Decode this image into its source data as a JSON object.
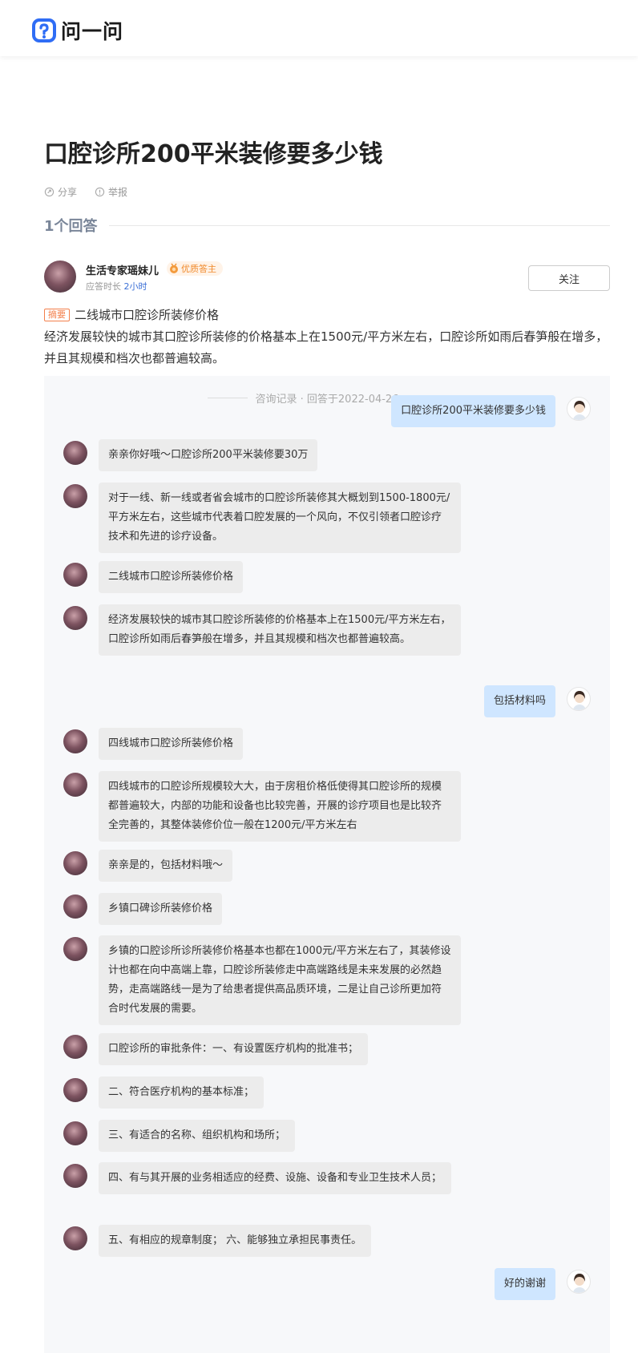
{
  "header": {
    "logo_text": "问一问"
  },
  "question": {
    "title": "口腔诊所200平米装修要多少钱",
    "share_label": "分享",
    "report_label": "举报"
  },
  "answers": {
    "count_label": "1个回答"
  },
  "author": {
    "name": "生活专家瑶妹儿",
    "badge": "优质答主",
    "meta_prefix": "应答时长",
    "meta_value": "2小时",
    "follow_label": "关注"
  },
  "summary": {
    "tag": "摘要",
    "heading": "二线城市口腔诊所装修价格",
    "body": "经济发展较快的城市其口腔诊所装修的价格基本上在1500元/平方米左右，口腔诊所如雨后春笋般在增多，并且其规模和档次也都普遍较高。"
  },
  "record": {
    "header": "咨询记录 · 回答于2022-04-26",
    "messages": [
      {
        "side": "user",
        "text": "口腔诊所200平米装修要多少钱"
      },
      {
        "side": "expert",
        "text": "亲亲你好哦～口腔诊所200平米装修要30万"
      },
      {
        "side": "expert",
        "text": "对于一线、新一线或者省会城市的口腔诊所装修其大概划到1500-1800元/平方米左右，这些城市代表着口腔发展的一个风向，不仅引领者口腔诊疗技术和先进的诊疗设备。"
      },
      {
        "side": "expert",
        "text": "二线城市口腔诊所装修价格"
      },
      {
        "side": "expert",
        "text": "经济发展较快的城市其口腔诊所装修的价格基本上在1500元/平方米左右，口腔诊所如雨后春笋般在增多，并且其规模和档次也都普遍较高。"
      },
      {
        "side": "user",
        "text": "包括材料吗"
      },
      {
        "side": "expert",
        "text": "四线城市口腔诊所装修价格"
      },
      {
        "side": "expert",
        "text": "四线城市的口腔诊所规模较大大，由于房租价格低使得其口腔诊所的规模都普遍较大，内部的功能和设备也比较完善，开展的诊疗项目也是比较齐全完善的，其整体装修价位一般在1200元/平方米左右"
      },
      {
        "side": "expert",
        "text": "亲亲是的，包括材料哦～"
      },
      {
        "side": "expert",
        "text": "乡镇口碑诊所装修价格"
      },
      {
        "side": "expert",
        "text": "乡镇的口腔诊所诊所装修价格基本也都在1000元/平方米左右了，其装修设计也都在向中高端上靠，口腔诊所装修走中高端路线是未来发展的必然趋势，走高端路线一是为了给患者提供高品质环境，二是让自己诊所更加符合时代发展的需要。"
      },
      {
        "side": "expert",
        "text": "口腔诊所的审批条件：一、有设置医疗机构的批准书；"
      },
      {
        "side": "expert",
        "text": "二、符合医疗机构的基本标准；"
      },
      {
        "side": "expert",
        "text": "三、有适合的名称、组织机构和场所；"
      },
      {
        "side": "expert",
        "text": "四、有与其开展的业务相适应的经费、设施、设备和专业卫生技术人员；"
      },
      {
        "side": "expert",
        "text": "五、有相应的规章制度；  六、能够独立承担民事责任。"
      },
      {
        "side": "user",
        "text": "好的谢谢"
      }
    ]
  }
}
